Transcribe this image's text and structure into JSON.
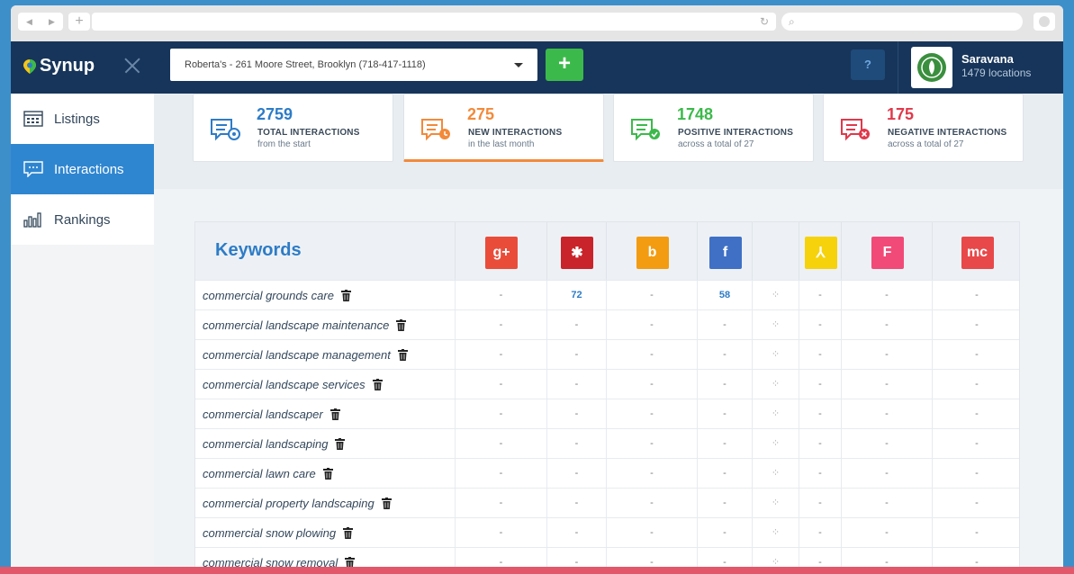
{
  "browser": {
    "nav_back": "◀",
    "nav_forward": "▶",
    "new_tab": "+",
    "reload": "↻",
    "search_icon": "⌕"
  },
  "app": {
    "logo_text": "Synup",
    "location": "Roberta's - 261 Moore Street, Brooklyn (718-417-1118)",
    "add_label": "+",
    "help_label": "?",
    "user_name": "Saravana",
    "user_locations": "1479 locations"
  },
  "sidebar": {
    "items": [
      {
        "label": "Listings",
        "icon": "listings-icon"
      },
      {
        "label": "Interactions",
        "icon": "interactions-icon"
      },
      {
        "label": "Rankings",
        "icon": "rankings-icon"
      }
    ]
  },
  "stats": [
    {
      "value": "2759",
      "title": "TOTAL INTERACTIONS",
      "sub": "from the start",
      "color": "#2d7cc7"
    },
    {
      "value": "275",
      "title": "NEW INTERACTIONS",
      "sub": "in the last month",
      "color": "#f28a3a"
    },
    {
      "value": "1748",
      "title": "POSITIVE INTERACTIONS",
      "sub": "across a total of 27",
      "color": "#3cb94b"
    },
    {
      "value": "175",
      "title": "NEGATIVE INTERACTIONS",
      "sub": "across a total of 27",
      "color": "#e0394b"
    }
  ],
  "table": {
    "title": "Keywords",
    "sources": [
      {
        "name": "google-plus",
        "glyph": "g+",
        "color": "#ea4c3a"
      },
      {
        "name": "yelp",
        "glyph": "✱",
        "color": "#c9242b"
      },
      {
        "name": "bing",
        "glyph": "b",
        "color": "#f39c12"
      },
      {
        "name": "facebook",
        "glyph": "f",
        "color": "#3f70c5"
      },
      {
        "name": "loading",
        "glyph": "",
        "color": ""
      },
      {
        "name": "yellowpages",
        "glyph": "⅄",
        "color": "#f5d20b"
      },
      {
        "name": "foursquare",
        "glyph": "F",
        "color": "#f24a78"
      },
      {
        "name": "merchantcircle",
        "glyph": "mc",
        "color": "#e8484a"
      }
    ],
    "rows": [
      {
        "keyword": "commercial grounds care",
        "cells": [
          "-",
          "72",
          "-",
          "58",
          "⁘",
          "-",
          "-",
          "-"
        ]
      },
      {
        "keyword": "commercial landscape maintenance",
        "cells": [
          "-",
          "-",
          "-",
          "-",
          "⁘",
          "-",
          "-",
          "-"
        ]
      },
      {
        "keyword": "commercial landscape management",
        "cells": [
          "-",
          "-",
          "-",
          "-",
          "⁘",
          "-",
          "-",
          "-"
        ]
      },
      {
        "keyword": "commercial landscape services",
        "cells": [
          "-",
          "-",
          "-",
          "-",
          "⁘",
          "-",
          "-",
          "-"
        ]
      },
      {
        "keyword": "commercial landscaper",
        "cells": [
          "-",
          "-",
          "-",
          "-",
          "⁘",
          "-",
          "-",
          "-"
        ]
      },
      {
        "keyword": "commercial landscaping",
        "cells": [
          "-",
          "-",
          "-",
          "-",
          "⁘",
          "-",
          "-",
          "-"
        ]
      },
      {
        "keyword": "commercial lawn care",
        "cells": [
          "-",
          "-",
          "-",
          "-",
          "⁘",
          "-",
          "-",
          "-"
        ]
      },
      {
        "keyword": "commercial property landscaping",
        "cells": [
          "-",
          "-",
          "-",
          "-",
          "⁘",
          "-",
          "-",
          "-"
        ]
      },
      {
        "keyword": "commercial snow plowing",
        "cells": [
          "-",
          "-",
          "-",
          "-",
          "⁘",
          "-",
          "-",
          "-"
        ]
      },
      {
        "keyword": "commercial snow removal",
        "cells": [
          "-",
          "-",
          "-",
          "-",
          "⁘",
          "-",
          "-",
          "-"
        ]
      }
    ]
  }
}
